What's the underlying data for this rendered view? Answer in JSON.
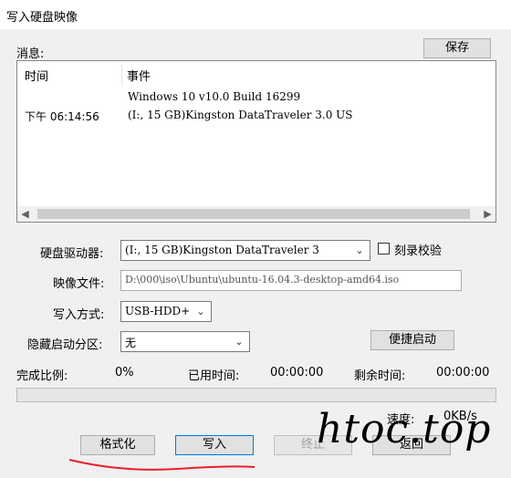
{
  "window": {
    "title": "写入硬盘映像"
  },
  "messages": {
    "label": "消息:",
    "save_button": "保存",
    "columns": {
      "time": "时间",
      "event": "事件"
    },
    "rows": [
      {
        "time": "",
        "event": "Windows 10 v10.0 Build 16299"
      },
      {
        "time": "下午 06:14:56",
        "event": "(I:, 15 GB)Kingston DataTraveler 3.0 US"
      }
    ]
  },
  "form": {
    "drive_label": "硬盘驱动器:",
    "drive_value": "(I:, 15 GB)Kingston DataTraveler 3",
    "verify_label": "刻录校验",
    "verify_checked": false,
    "image_label": "映像文件:",
    "image_value": "D:\\000\\iso\\Ubuntu\\ubuntu-16.04.3-desktop-amd64.iso",
    "method_label": "写入方式:",
    "method_value": "USB-HDD+",
    "hidden_label": "隐藏启动分区:",
    "hidden_value": "无",
    "quick_boot_button": "便捷启动"
  },
  "status": {
    "complete_label": "完成比例:",
    "complete_value": "0%",
    "elapsed_label": "已用时间:",
    "elapsed_value": "00:00:00",
    "remaining_label": "剩余时间:",
    "remaining_value": "00:00:00",
    "progress": 0,
    "speed_label": "速度:",
    "speed_value": "0KB/s"
  },
  "buttons": {
    "format": "格式化",
    "write": "写入",
    "stop": "终止",
    "back": "返回"
  },
  "watermark": "htoc.top",
  "colors": {
    "annotation": "#e8202a"
  }
}
